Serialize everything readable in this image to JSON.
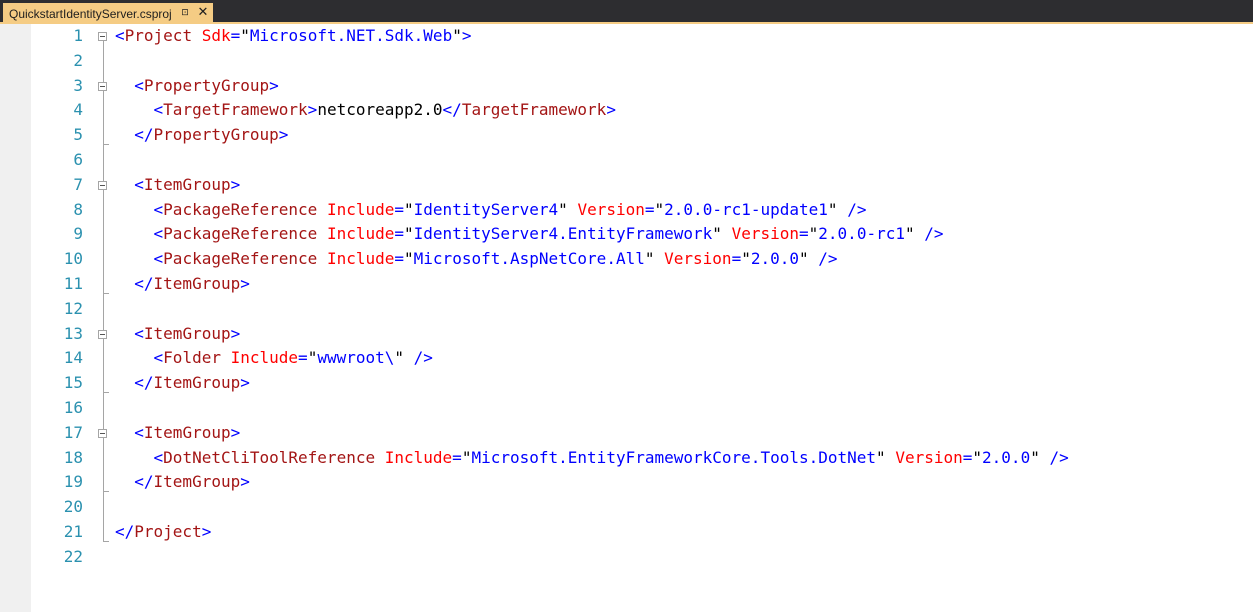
{
  "tab": {
    "title": "QuickstartIdentityServer.csproj",
    "pin_glyph": "⊡",
    "close_glyph": "✕"
  },
  "editor": {
    "colors": {
      "bracket": "#0000ff",
      "element": "#a31515",
      "attribute": "#ff0000",
      "value": "#0000ff",
      "text": "#000000",
      "line_number": "#2b91af",
      "tab_active": "#f5cc84",
      "tab_strip": "#2d2d30"
    },
    "lines": [
      {
        "n": "1",
        "fold": "open",
        "tokens": [
          [
            "b",
            "<"
          ],
          [
            "e",
            "Project"
          ],
          [
            "t",
            " "
          ],
          [
            "a",
            "Sdk"
          ],
          [
            "b",
            "="
          ],
          [
            "t",
            "\""
          ],
          [
            "v",
            "Microsoft.NET.Sdk.Web"
          ],
          [
            "t",
            "\""
          ],
          [
            "b",
            ">"
          ]
        ]
      },
      {
        "n": "2",
        "tokens": []
      },
      {
        "n": "3",
        "fold": "open",
        "tokens": [
          [
            "t",
            "  "
          ],
          [
            "b",
            "<"
          ],
          [
            "e",
            "PropertyGroup"
          ],
          [
            "b",
            ">"
          ]
        ]
      },
      {
        "n": "4",
        "tokens": [
          [
            "t",
            "    "
          ],
          [
            "b",
            "<"
          ],
          [
            "e",
            "TargetFramework"
          ],
          [
            "b",
            ">"
          ],
          [
            "t",
            "netcoreapp2.0"
          ],
          [
            "b",
            "</"
          ],
          [
            "e",
            "TargetFramework"
          ],
          [
            "b",
            ">"
          ]
        ]
      },
      {
        "n": "5",
        "tokens": [
          [
            "t",
            "  "
          ],
          [
            "b",
            "</"
          ],
          [
            "e",
            "PropertyGroup"
          ],
          [
            "b",
            ">"
          ]
        ]
      },
      {
        "n": "6",
        "tokens": []
      },
      {
        "n": "7",
        "fold": "open",
        "tokens": [
          [
            "t",
            "  "
          ],
          [
            "b",
            "<"
          ],
          [
            "e",
            "ItemGroup"
          ],
          [
            "b",
            ">"
          ]
        ]
      },
      {
        "n": "8",
        "tokens": [
          [
            "t",
            "    "
          ],
          [
            "b",
            "<"
          ],
          [
            "e",
            "PackageReference"
          ],
          [
            "t",
            " "
          ],
          [
            "a",
            "Include"
          ],
          [
            "b",
            "="
          ],
          [
            "t",
            "\""
          ],
          [
            "v",
            "IdentityServer4"
          ],
          [
            "t",
            "\""
          ],
          [
            "t",
            " "
          ],
          [
            "a",
            "Version"
          ],
          [
            "b",
            "="
          ],
          [
            "t",
            "\""
          ],
          [
            "v",
            "2.0.0-rc1-update1"
          ],
          [
            "t",
            "\""
          ],
          [
            "t",
            " "
          ],
          [
            "b",
            "/>"
          ]
        ]
      },
      {
        "n": "9",
        "tokens": [
          [
            "t",
            "    "
          ],
          [
            "b",
            "<"
          ],
          [
            "e",
            "PackageReference"
          ],
          [
            "t",
            " "
          ],
          [
            "a",
            "Include"
          ],
          [
            "b",
            "="
          ],
          [
            "t",
            "\""
          ],
          [
            "v",
            "IdentityServer4.EntityFramework"
          ],
          [
            "t",
            "\""
          ],
          [
            "t",
            " "
          ],
          [
            "a",
            "Version"
          ],
          [
            "b",
            "="
          ],
          [
            "t",
            "\""
          ],
          [
            "v",
            "2.0.0-rc1"
          ],
          [
            "t",
            "\""
          ],
          [
            "t",
            " "
          ],
          [
            "b",
            "/>"
          ]
        ]
      },
      {
        "n": "10",
        "tokens": [
          [
            "t",
            "    "
          ],
          [
            "b",
            "<"
          ],
          [
            "e",
            "PackageReference"
          ],
          [
            "t",
            " "
          ],
          [
            "a",
            "Include"
          ],
          [
            "b",
            "="
          ],
          [
            "t",
            "\""
          ],
          [
            "v",
            "Microsoft.AspNetCore.All"
          ],
          [
            "t",
            "\""
          ],
          [
            "t",
            " "
          ],
          [
            "a",
            "Version"
          ],
          [
            "b",
            "="
          ],
          [
            "t",
            "\""
          ],
          [
            "v",
            "2.0.0"
          ],
          [
            "t",
            "\""
          ],
          [
            "t",
            " "
          ],
          [
            "b",
            "/>"
          ]
        ]
      },
      {
        "n": "11",
        "tokens": [
          [
            "t",
            "  "
          ],
          [
            "b",
            "</"
          ],
          [
            "e",
            "ItemGroup"
          ],
          [
            "b",
            ">"
          ]
        ]
      },
      {
        "n": "12",
        "tokens": []
      },
      {
        "n": "13",
        "fold": "open",
        "tokens": [
          [
            "t",
            "  "
          ],
          [
            "b",
            "<"
          ],
          [
            "e",
            "ItemGroup"
          ],
          [
            "b",
            ">"
          ]
        ]
      },
      {
        "n": "14",
        "tokens": [
          [
            "t",
            "    "
          ],
          [
            "b",
            "<"
          ],
          [
            "e",
            "Folder"
          ],
          [
            "t",
            " "
          ],
          [
            "a",
            "Include"
          ],
          [
            "b",
            "="
          ],
          [
            "t",
            "\""
          ],
          [
            "v",
            "wwwroot\\"
          ],
          [
            "t",
            "\""
          ],
          [
            "t",
            " "
          ],
          [
            "b",
            "/>"
          ]
        ]
      },
      {
        "n": "15",
        "tokens": [
          [
            "t",
            "  "
          ],
          [
            "b",
            "</"
          ],
          [
            "e",
            "ItemGroup"
          ],
          [
            "b",
            ">"
          ]
        ]
      },
      {
        "n": "16",
        "tokens": []
      },
      {
        "n": "17",
        "fold": "open",
        "tokens": [
          [
            "t",
            "  "
          ],
          [
            "b",
            "<"
          ],
          [
            "e",
            "ItemGroup"
          ],
          [
            "b",
            ">"
          ]
        ]
      },
      {
        "n": "18",
        "tokens": [
          [
            "t",
            "    "
          ],
          [
            "b",
            "<"
          ],
          [
            "e",
            "DotNetCliToolReference"
          ],
          [
            "t",
            " "
          ],
          [
            "a",
            "Include"
          ],
          [
            "b",
            "="
          ],
          [
            "t",
            "\""
          ],
          [
            "v",
            "Microsoft.EntityFrameworkCore.Tools.DotNet"
          ],
          [
            "t",
            "\""
          ],
          [
            "t",
            " "
          ],
          [
            "a",
            "Version"
          ],
          [
            "b",
            "="
          ],
          [
            "t",
            "\""
          ],
          [
            "v",
            "2.0.0"
          ],
          [
            "t",
            "\""
          ],
          [
            "t",
            " "
          ],
          [
            "b",
            "/>"
          ]
        ]
      },
      {
        "n": "19",
        "tokens": [
          [
            "t",
            "  "
          ],
          [
            "b",
            "</"
          ],
          [
            "e",
            "ItemGroup"
          ],
          [
            "b",
            ">"
          ]
        ]
      },
      {
        "n": "20",
        "tokens": []
      },
      {
        "n": "21",
        "tokens": [
          [
            "b",
            "</"
          ],
          [
            "e",
            "Project"
          ],
          [
            "b",
            ">"
          ]
        ]
      },
      {
        "n": "22",
        "tokens": []
      }
    ]
  }
}
